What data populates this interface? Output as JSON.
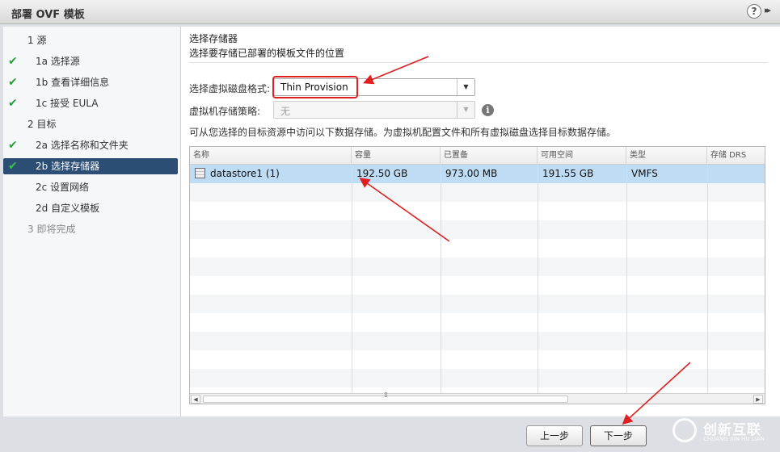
{
  "window": {
    "title": "部署 OVF 模板",
    "help_glyph": "?",
    "expand_glyph": "▸▸"
  },
  "sidebar": {
    "steps": [
      {
        "label": "1  源",
        "completed": false,
        "selected": false
      },
      {
        "label": "1a 选择源",
        "completed": true,
        "selected": false
      },
      {
        "label": "1b 查看详细信息",
        "completed": true,
        "selected": false
      },
      {
        "label": "1c 接受 EULA",
        "completed": true,
        "selected": false
      },
      {
        "label": "2  目标",
        "completed": false,
        "selected": false
      },
      {
        "label": "2a 选择名称和文件夹",
        "completed": true,
        "selected": false
      },
      {
        "label": "2b 选择存储器",
        "completed": true,
        "selected": true
      },
      {
        "label": "2c 设置网络",
        "completed": false,
        "selected": false
      },
      {
        "label": "2d 自定义模板",
        "completed": false,
        "selected": false
      },
      {
        "label": "3  即将完成",
        "completed": false,
        "selected": false,
        "disabled": true
      }
    ],
    "check_glyph": "✔"
  },
  "main": {
    "section_title": "选择存储器",
    "section_desc": "选择要存储已部署的模板文件的位置",
    "disk_format_label": "选择虚拟磁盘格式:",
    "disk_format_value": "Thin Provision",
    "storage_policy_label": "虚拟机存储策略:",
    "storage_policy_value": "无",
    "info_glyph": "i",
    "hint": "可从您选择的目标资源中访问以下数据存储。为虚拟机配置文件和所有虚拟磁盘选择目标数据存储。",
    "dropdown_arrow": "▼"
  },
  "table": {
    "columns": [
      "名称",
      "容量",
      "已置备",
      "可用空间",
      "类型",
      "存储 DRS"
    ],
    "rows": [
      {
        "name": "datastore1 (1)",
        "capacity": "192.50 GB",
        "provisioned": "973.00 MB",
        "free": "191.55 GB",
        "type": "VMFS",
        "drs": ""
      }
    ],
    "scroll_left": "◀",
    "scroll_right": "▶",
    "grip": "⁞⁞"
  },
  "footer": {
    "back_label": "上一步",
    "next_label": "下一步"
  },
  "watermark": {
    "text": "创新互联",
    "sub": "CHUANG XIN HU LIAN"
  },
  "colors": {
    "accent": "#2c4e74",
    "check": "#2e9e3f",
    "selected_row": "#bfdcf5",
    "annotation": "#e02020"
  }
}
